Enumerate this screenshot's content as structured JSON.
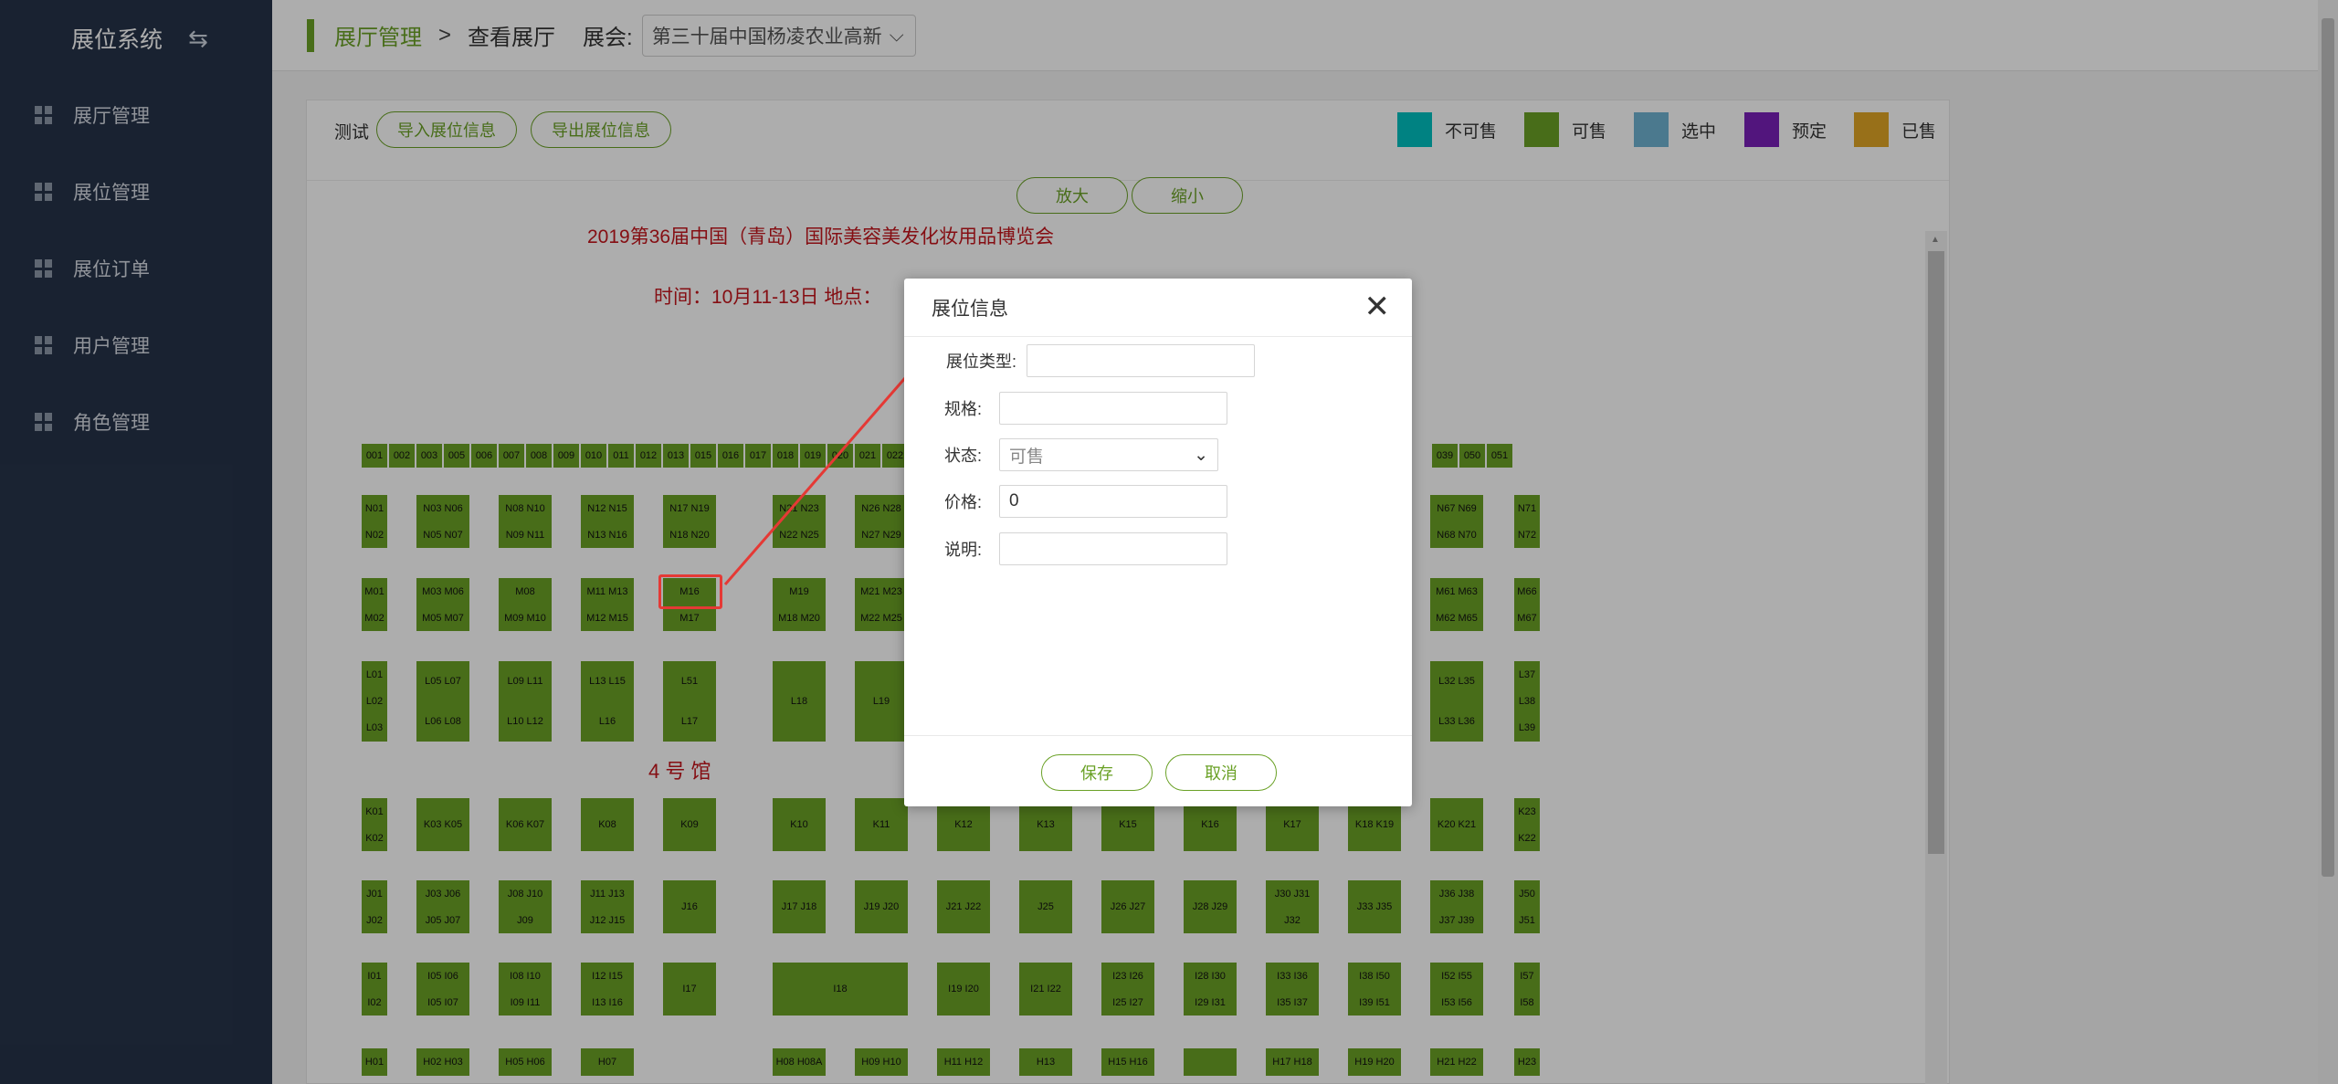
{
  "sidebar": {
    "title": "展位系统",
    "switch_icon": "switch-icon",
    "items": [
      {
        "label": "展厅管理"
      },
      {
        "label": "展位管理"
      },
      {
        "label": "展位订单"
      },
      {
        "label": "用户管理"
      },
      {
        "label": "角色管理"
      }
    ]
  },
  "topbar": {
    "crumb1": "展厅管理",
    "sep": ">",
    "crumb2": "查看展厅",
    "exhibition_label": "展会:",
    "exhibition_value": "第三十届中国杨凌农业高新"
  },
  "toolbar": {
    "label": "测试",
    "import_btn": "导入展位信息",
    "export_btn": "导出展位信息",
    "zoom_in": "放大",
    "zoom_out": "缩小"
  },
  "legend": [
    {
      "label": "不可售",
      "color": "#00c0c0"
    },
    {
      "label": "可售",
      "color": "#6aa126"
    },
    {
      "label": "选中",
      "color": "#6fb3d2"
    },
    {
      "label": "预定",
      "color": "#7a1fb8"
    },
    {
      "label": "已售",
      "color": "#e0a526"
    }
  ],
  "floorplan": {
    "title": "2019第36届中国（青岛）国际美容美发化妆用品博览会",
    "subtitle": "时间：10月11-13日 地点：",
    "hall": "4 号 馆",
    "top_strip": [
      "001",
      "002",
      "003",
      "005",
      "006",
      "007",
      "008",
      "009",
      "010",
      "011",
      "012",
      "013",
      "015",
      "016",
      "017",
      "018",
      "019",
      "020",
      "021",
      "022",
      "039",
      "050",
      "051"
    ]
  },
  "dialog": {
    "title": "展位信息",
    "fields": {
      "type_label": "展位类型:",
      "type_value": "",
      "spec_label": "规格:",
      "spec_value": "",
      "status_label": "状态:",
      "status_value": "可售",
      "price_label": "价格:",
      "price_value": "0",
      "desc_label": "说明:",
      "desc_value": ""
    },
    "save": "保存",
    "cancel": "取消"
  }
}
